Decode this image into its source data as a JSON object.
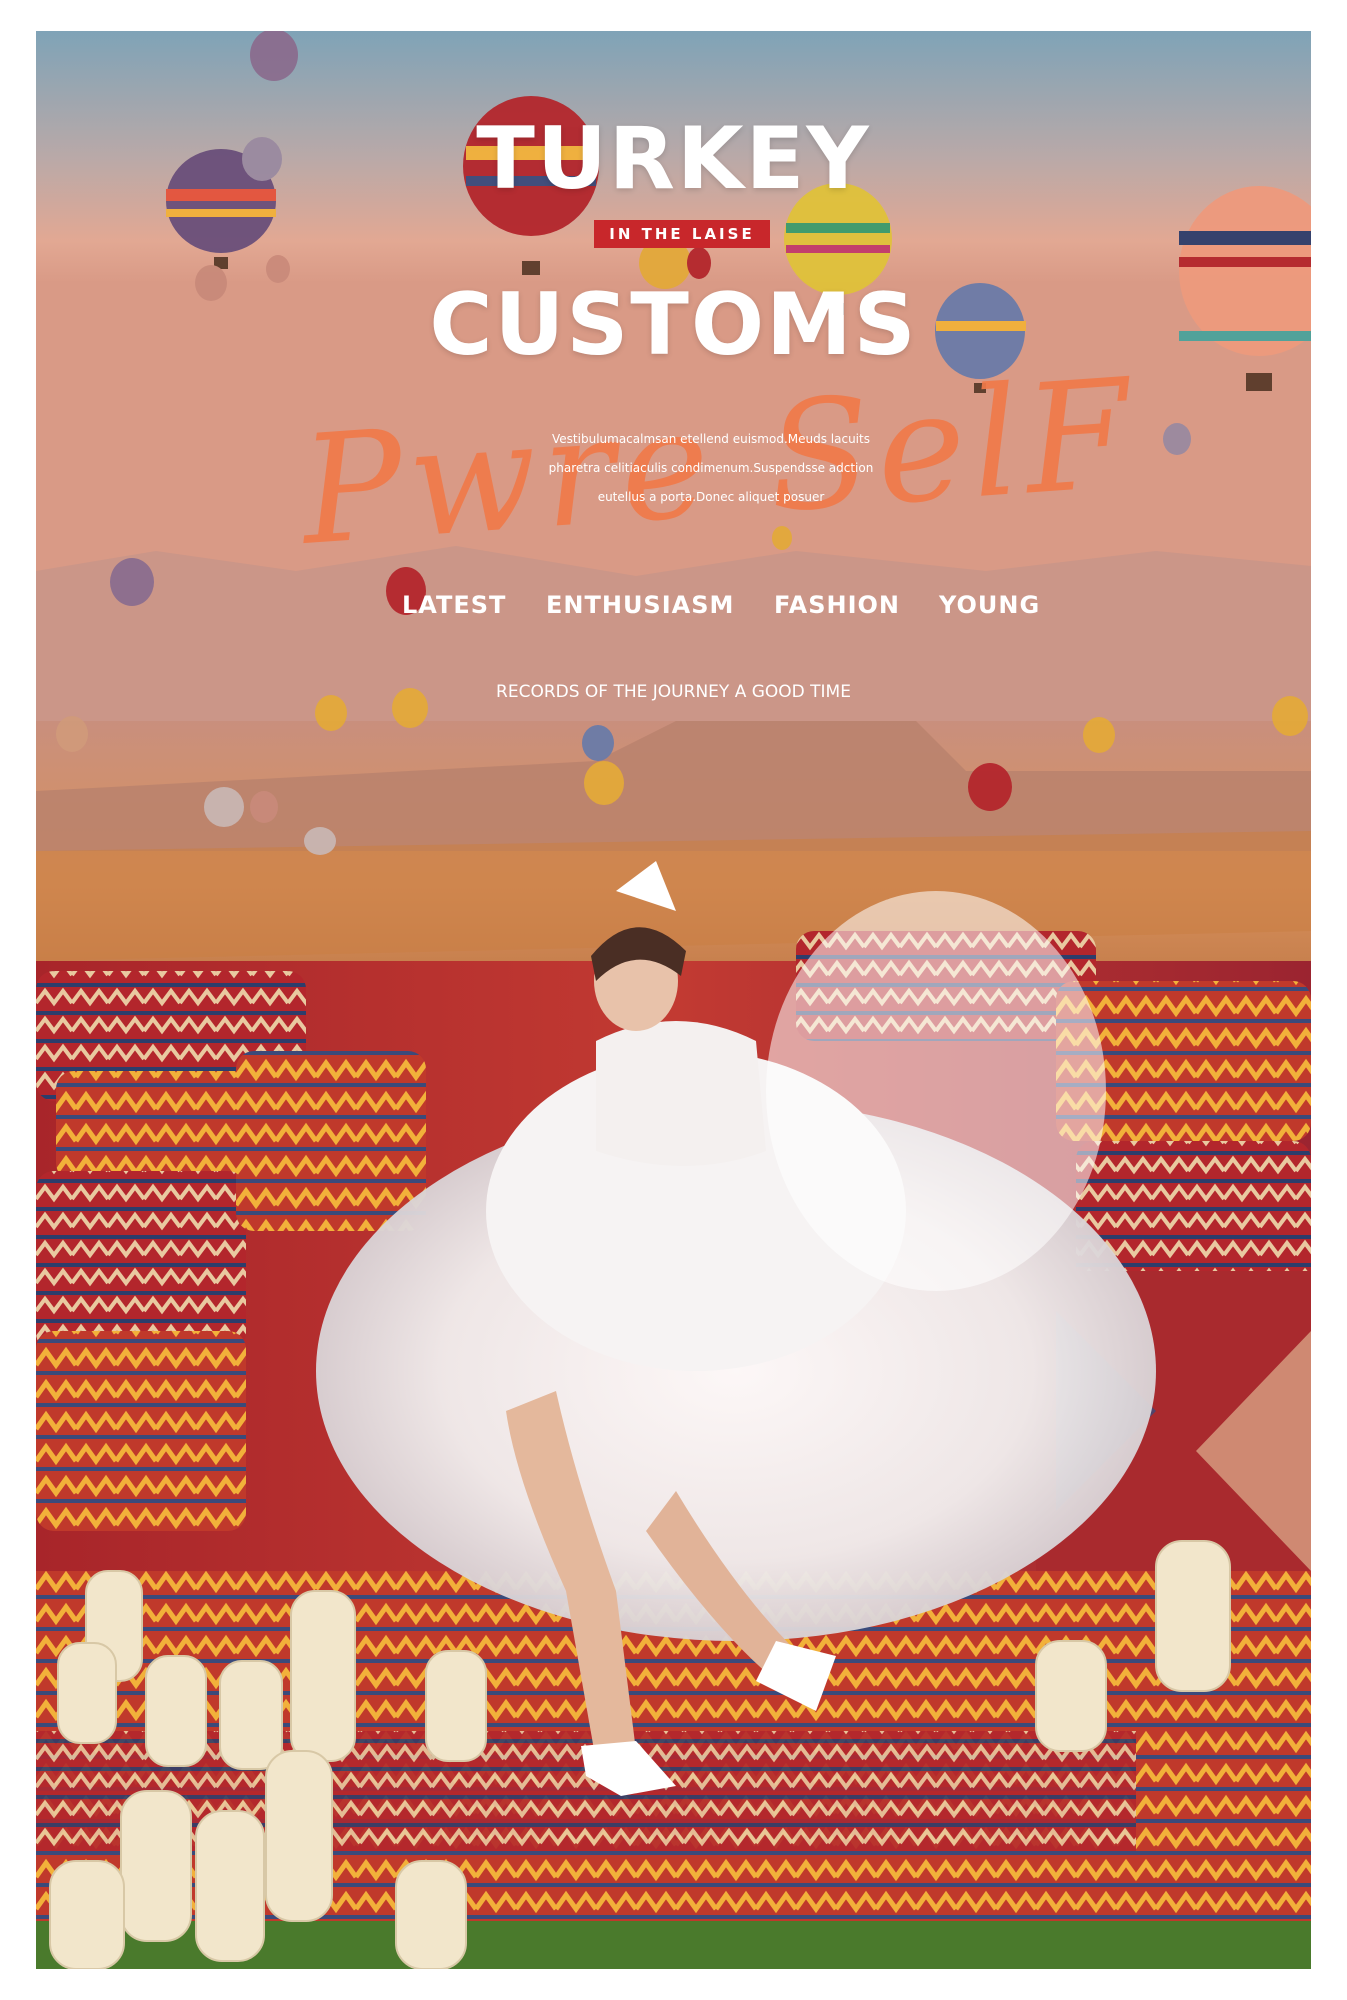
{
  "poster": {
    "title_top": "TURKEY",
    "tag": "IN THE LAISE",
    "title_bottom": "CUSTOMS",
    "script_text": "Pwre SelF",
    "description": [
      "Vestibulumacalmsan etellend euismod.Meuds lacuits",
      "pharetra celitiaculis condimenum.Suspendsse adction",
      "eutellus a porta.Donec aliquet posuer"
    ],
    "keywords": [
      "LATEST",
      "ENTHUSIASM",
      "FASHION",
      "YOUNG"
    ],
    "subtitle": "RECORDS OF THE JOURNEY  A GOOD TIME"
  },
  "colors": {
    "accent_red": "#c8272b",
    "script_orange": "#f07a4a",
    "sky_top": "#7fa3b7",
    "sky_bottom": "#e7a890"
  }
}
